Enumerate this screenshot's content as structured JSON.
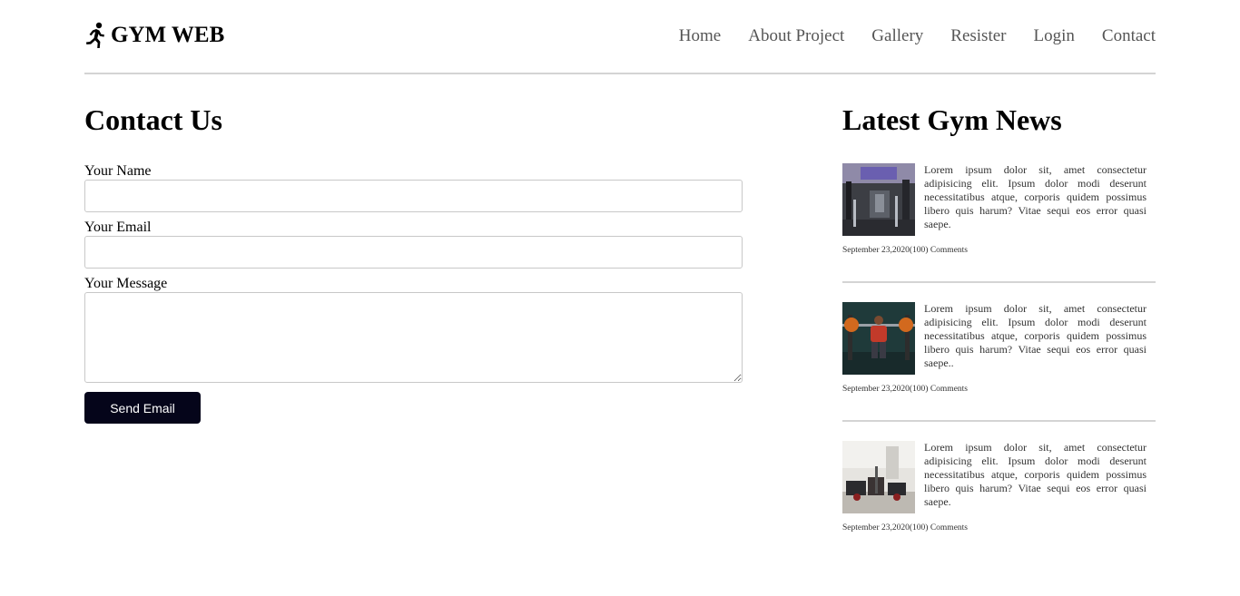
{
  "header": {
    "brand": "GYM WEB",
    "brand_icon": "running-person-icon",
    "nav": [
      "Home",
      "About Project",
      "Gallery",
      "Resister",
      "Login",
      "Contact"
    ]
  },
  "contact": {
    "title": "Contact Us",
    "name_label": "Your Name",
    "name_value": "",
    "email_label": "Your Email",
    "email_value": "",
    "message_label": "Your Message",
    "message_value": "",
    "send_label": "Send Email",
    "send_color": "#05051a"
  },
  "news": {
    "title": "Latest Gym News",
    "items": [
      {
        "text": "Lorem ipsum dolor sit, amet consectetur adipisicing elit. Ipsum dolor modi deserunt necessitatibus atque, corporis quidem possimus libero quis harum? Vitae sequi eos error quasi saepe.",
        "meta": "September 23,2020(100) Comments"
      },
      {
        "text": "Lorem ipsum dolor sit, amet consectetur adipisicing elit. Ipsum dolor modi deserunt necessitatibus atque, corporis quidem possimus libero quis harum? Vitae sequi eos error quasi saepe..",
        "meta": "September 23,2020(100) Comments"
      },
      {
        "text": "Lorem ipsum dolor sit, amet consectetur adipisicing elit. Ipsum dolor modi deserunt necessitatibus atque, corporis quidem possimus libero quis harum? Vitae sequi eos error quasi saepe.",
        "meta": "September 23,2020(100) Comments"
      }
    ]
  }
}
